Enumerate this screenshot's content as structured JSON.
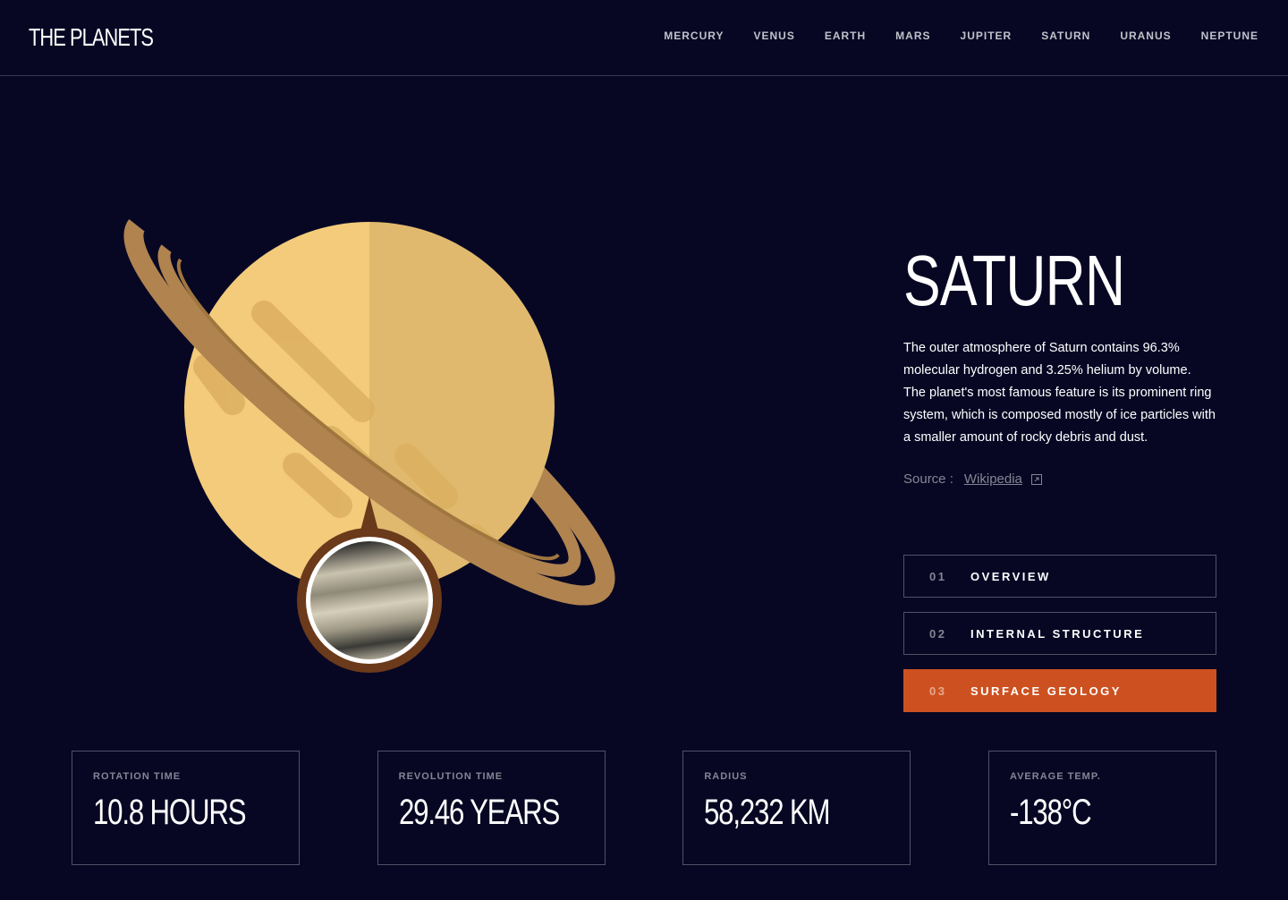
{
  "header": {
    "logo": "THE PLANETS",
    "nav": [
      "MERCURY",
      "VENUS",
      "EARTH",
      "MARS",
      "JUPITER",
      "SATURN",
      "URANUS",
      "NEPTUNE"
    ]
  },
  "planet": {
    "name": "SATURN",
    "description": "The outer atmosphere of Saturn contains 96.3% molecular hydrogen and 3.25% helium by volume. The planet's most famous feature is its prominent ring system, which is composed mostly of ice particles with a smaller amount of rocky debris and dust.",
    "source_label": "Source :",
    "source_link": "Wikipedia"
  },
  "tabs": [
    {
      "num": "01",
      "label": "OVERVIEW"
    },
    {
      "num": "02",
      "label": "INTERNAL STRUCTURE"
    },
    {
      "num": "03",
      "label": "SURFACE GEOLOGY"
    }
  ],
  "stats": [
    {
      "label": "ROTATION TIME",
      "value": "10.8 HOURS"
    },
    {
      "label": "REVOLUTION TIME",
      "value": "29.46 YEARS"
    },
    {
      "label": "RADIUS",
      "value": "58,232 KM"
    },
    {
      "label": "AVERAGE TEMP.",
      "value": "-138°C"
    }
  ],
  "colors": {
    "background": "#070724",
    "accent": "#cd5120",
    "planet_light": "#f3cb7a",
    "planet_dark": "#e0b96e",
    "ring": "#b0834f"
  }
}
